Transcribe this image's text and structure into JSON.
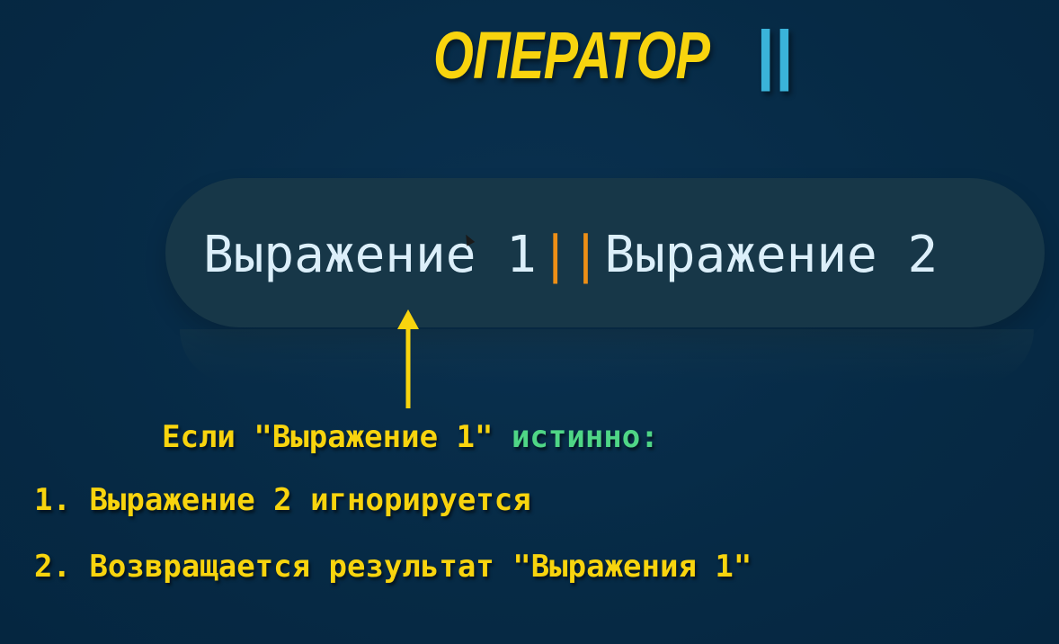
{
  "title": {
    "word": "ОПЕРАТОР",
    "operator": "||"
  },
  "expression": {
    "left": "Выражение 1",
    "operator": "||",
    "right": "Выражение 2"
  },
  "condition": {
    "prefix": "Если \"Выражение 1\"",
    "state": "истинно:"
  },
  "steps": [
    {
      "number": "1.",
      "text": "Выражение 2 игнорируется"
    },
    {
      "number": "2.",
      "text": "Возвращается результат \"Выражения 1\""
    }
  ],
  "colors": {
    "background": "#062a45",
    "title_yellow": "#f8d40e",
    "title_operator_blue": "#3ab3d9",
    "expression_text": "#dceffa",
    "expression_operator": "#ee8f16",
    "condition_green": "#4fd686",
    "pill": "#173748"
  },
  "icons": {
    "arrow": "arrow-up-icon",
    "cursor": "mouse-pointer-icon"
  }
}
